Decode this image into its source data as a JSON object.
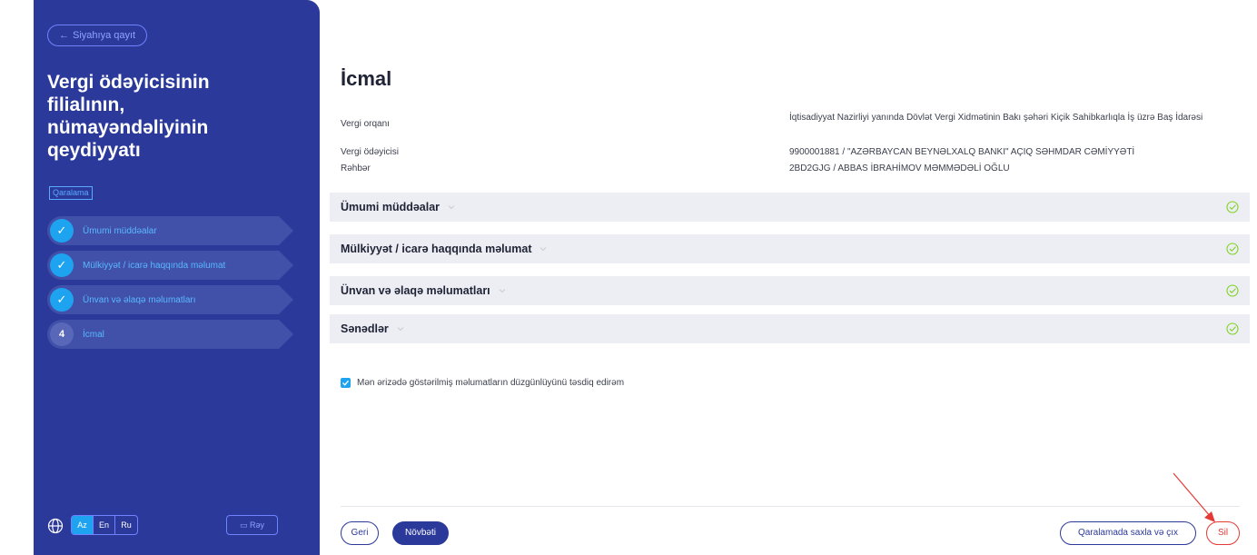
{
  "sidebar": {
    "back_label": "Siyahıya qayıt",
    "title": "Vergi ödəyicisinin filialının, nümayəndəliyinin qeydiyyatı",
    "draft_badge": "Qaralama",
    "steps": [
      {
        "label": "Ümumi müddəalar",
        "status": "done"
      },
      {
        "label": "Mülkiyyət / icarə haqqında məlumat",
        "status": "done"
      },
      {
        "label": "Ünvan və əlaqə məlumatları",
        "status": "done"
      },
      {
        "number": "4",
        "label": "İcmal",
        "status": "active"
      }
    ],
    "languages": [
      "Az",
      "En",
      "Ru"
    ],
    "active_language": "Az",
    "feedback_label": "Rəy"
  },
  "main": {
    "title": "İcmal",
    "info": [
      {
        "label": "Vergi orqanı",
        "value": "İqtisadiyyat Nazirliyi yanında Dövlət Vergi Xidmətinin Bakı şəhəri Kiçik Sahibkarlıqla İş üzrə Baş İdarəsi"
      },
      {
        "label": "Vergi ödəyicisi",
        "value": "9900001881 / \"AZƏRBAYCAN BEYNƏLXALQ BANKI\" AÇIQ SƏHMDAR CƏMİYYƏTİ"
      },
      {
        "label": "Rəhbər",
        "value": "2BD2GJG / ABBAS İBRAHİMOV MƏMMƏDƏLİ OĞLU"
      }
    ],
    "sections": [
      {
        "label": "Ümumi müddəalar"
      },
      {
        "label": "Mülkiyyət / icarə haqqında məlumat"
      },
      {
        "label": "Ünvan və əlaqə məlumatları"
      },
      {
        "label": "Sənədlər"
      }
    ],
    "confirm_text": "Mən ərizədə göstərilmiş məlumatların düzgünlüyünü təsdiq edirəm",
    "confirm_checked": true
  },
  "footer": {
    "back_label": "Geri",
    "next_label": "Növbəti",
    "save_draft_label": "Qaralamada saxla və çıx",
    "delete_label": "Sil"
  },
  "colors": {
    "sidebar_bg": "#2b3a9a",
    "accent": "#1ea3f0",
    "success": "#7ed321",
    "danger": "#e53935"
  }
}
